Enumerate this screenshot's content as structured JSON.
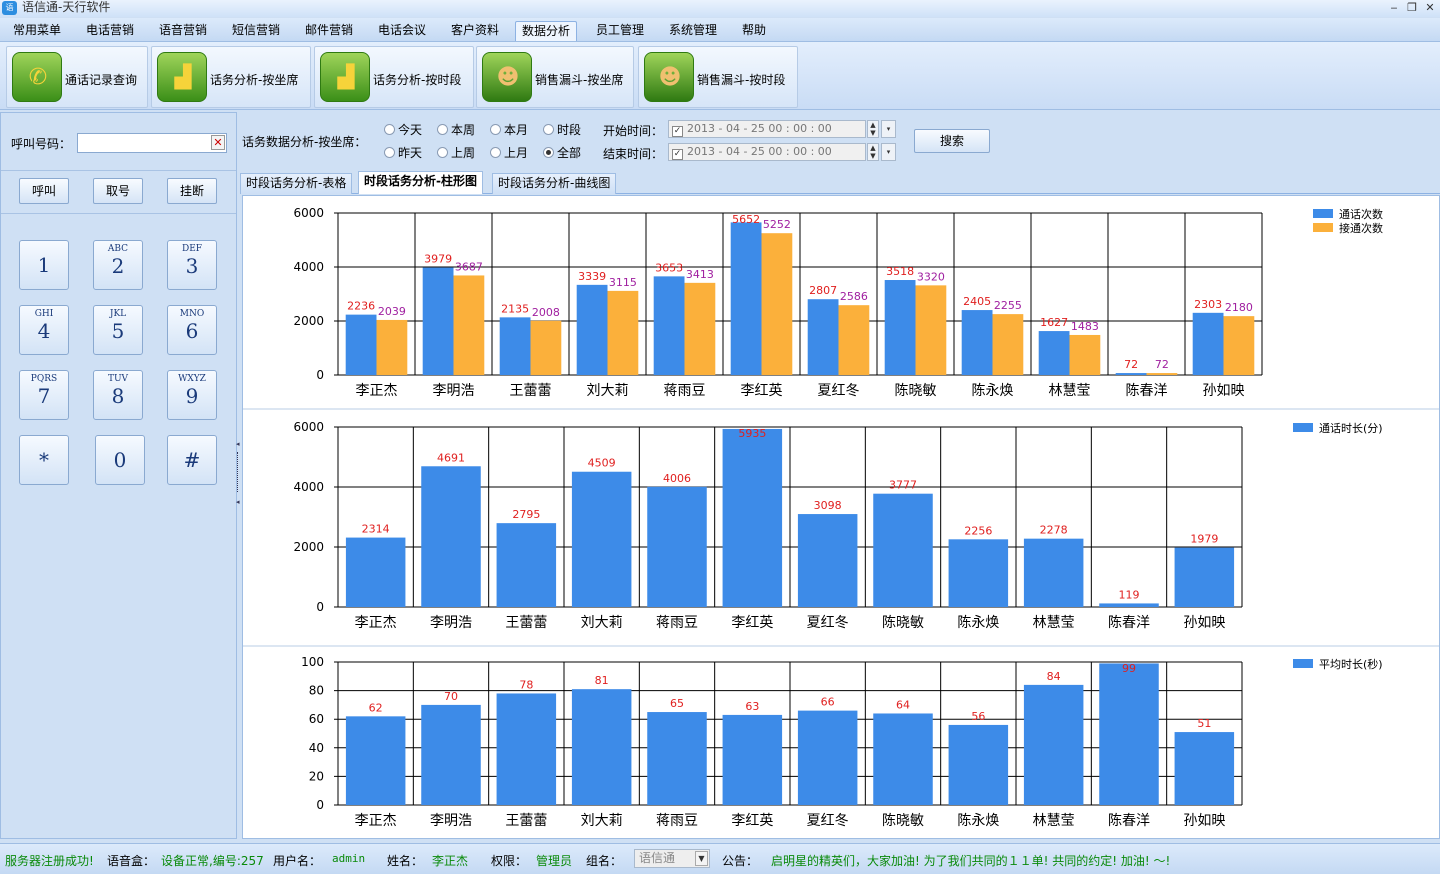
{
  "window": {
    "title": "语信通-天行软件"
  },
  "menu": [
    {
      "label": "常用菜单"
    },
    {
      "label": "电话营销"
    },
    {
      "label": "语音营销"
    },
    {
      "label": "短信营销"
    },
    {
      "label": "邮件营销"
    },
    {
      "label": "电话会议"
    },
    {
      "label": "客户资料"
    },
    {
      "label": "数据分析",
      "active": true
    },
    {
      "label": "员工管理"
    },
    {
      "label": "系统管理"
    },
    {
      "label": "帮助"
    }
  ],
  "ribbon": [
    {
      "label": "通话记录查询",
      "icon": "phone-call-icon"
    },
    {
      "label": "话务分析-按坐席",
      "icon": "bar-chart-icon"
    },
    {
      "label": "话务分析-按时段",
      "icon": "bar-chart-icon"
    },
    {
      "label": "销售漏斗-按坐席",
      "icon": "people-icon"
    },
    {
      "label": "销售漏斗-按时段",
      "icon": "people-icon"
    }
  ],
  "dialer": {
    "number_label": "呼叫号码：",
    "number_value": "",
    "call_label": "呼叫",
    "pickup_label": "取号",
    "hangup_label": "挂断",
    "keys": [
      {
        "main": "1",
        "sub": ""
      },
      {
        "main": "2",
        "sub": "ABC"
      },
      {
        "main": "3",
        "sub": "DEF"
      },
      {
        "main": "4",
        "sub": "GHI"
      },
      {
        "main": "5",
        "sub": "JKL"
      },
      {
        "main": "6",
        "sub": "MNO"
      },
      {
        "main": "7",
        "sub": "PQRS"
      },
      {
        "main": "8",
        "sub": "TUV"
      },
      {
        "main": "9",
        "sub": "WXYZ"
      },
      {
        "main": "*",
        "sub": ""
      },
      {
        "main": "0",
        "sub": ""
      },
      {
        "main": "#",
        "sub": ""
      }
    ]
  },
  "filter": {
    "title": "话务数据分析-按坐席：",
    "radios_row1": [
      "今天",
      "本周",
      "本月",
      "时段"
    ],
    "radios_row2": [
      "昨天",
      "上周",
      "上月",
      "全部"
    ],
    "selected": "全部",
    "start_label": "开始时间：",
    "end_label": "结束时间：",
    "start_value": "2013 - 04 - 25    00 : 00 : 00",
    "end_value": "2013 - 04 - 25    00 : 00 : 00",
    "search_label": "搜索"
  },
  "tabs": [
    {
      "label": "时段话务分析-表格"
    },
    {
      "label": "时段话务分析-柱形图",
      "active": true
    },
    {
      "label": "时段话务分析-曲线图"
    }
  ],
  "colors": {
    "blue": "#3d8be8",
    "orange": "#fbb03b",
    "label_red": "#e0201f",
    "label_purple": "#a020a0"
  },
  "chart_data": [
    {
      "type": "bar",
      "categories": [
        "李正杰",
        "李明浩",
        "王蕾蕾",
        "刘大莉",
        "蒋雨豆",
        "李红英",
        "夏红冬",
        "陈晓敏",
        "陈永焕",
        "林慧莹",
        "陈春洋",
        "孙如映"
      ],
      "series": [
        {
          "name": "通话次数",
          "values": [
            2236,
            3979,
            2135,
            3339,
            3653,
            5652,
            2807,
            3518,
            2405,
            1627,
            72,
            2303
          ]
        },
        {
          "name": "接通次数",
          "values": [
            2039,
            3687,
            2008,
            3115,
            3413,
            5252,
            2586,
            3320,
            2255,
            1483,
            72,
            2180
          ]
        }
      ],
      "yticks": [
        0,
        2000,
        4000,
        6000
      ],
      "ylim": [
        0,
        6000
      ],
      "grid": true,
      "legend": "top-right"
    },
    {
      "type": "bar",
      "categories": [
        "李正杰",
        "李明浩",
        "王蕾蕾",
        "刘大莉",
        "蒋雨豆",
        "李红英",
        "夏红冬",
        "陈晓敏",
        "陈永焕",
        "林慧莹",
        "陈春洋",
        "孙如映"
      ],
      "series": [
        {
          "name": "通话时长(分)",
          "values": [
            2314,
            4691,
            2795,
            4509,
            4006,
            5935,
            3098,
            3777,
            2256,
            2278,
            119,
            1979
          ]
        }
      ],
      "yticks": [
        0,
        2000,
        4000,
        6000
      ],
      "ylim": [
        0,
        6000
      ],
      "grid": true,
      "legend": "top-right"
    },
    {
      "type": "bar",
      "categories": [
        "李正杰",
        "李明浩",
        "王蕾蕾",
        "刘大莉",
        "蒋雨豆",
        "李红英",
        "夏红冬",
        "陈晓敏",
        "陈永焕",
        "林慧莹",
        "陈春洋",
        "孙如映"
      ],
      "series": [
        {
          "name": "平均时长(秒)",
          "values": [
            62,
            70,
            78,
            81,
            65,
            63,
            66,
            64,
            56,
            84,
            99,
            51
          ]
        }
      ],
      "yticks": [
        0,
        20,
        40,
        60,
        80,
        100
      ],
      "ylim": [
        0,
        100
      ],
      "grid": true,
      "legend": "top-right"
    }
  ],
  "status": {
    "msg": "服务器注册成功!",
    "box_label": "语音盒：",
    "box_value": "设备正常,编号:257",
    "user_label": "用户名：",
    "user_value": "admin",
    "name_label": "姓名：",
    "name_value": "李正杰",
    "role_label": "权限：",
    "role_value": "管理员",
    "group_label": "组名：",
    "group_value": "语信通",
    "notice_label": "公告：",
    "notice_value": "启明星的精英们，大家加油! 为了我们共同的１１单! 共同的约定! 加油! ～!"
  }
}
